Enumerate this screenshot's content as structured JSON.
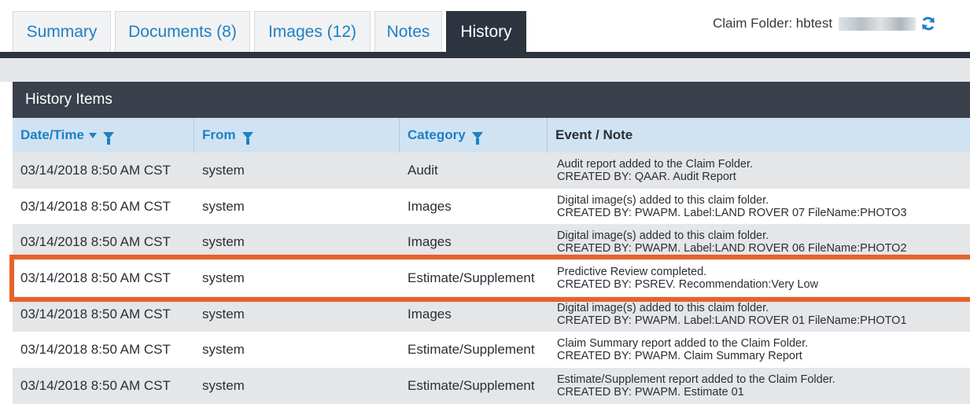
{
  "tabs": [
    {
      "label": "Summary"
    },
    {
      "label": "Documents (8)"
    },
    {
      "label": "Images (12)"
    },
    {
      "label": "Notes"
    },
    {
      "label": "History",
      "active": true
    }
  ],
  "folder": {
    "label": "Claim Folder: hbtest"
  },
  "panel": {
    "title": "History Items"
  },
  "columns": [
    {
      "label": "Date/Time"
    },
    {
      "label": "From"
    },
    {
      "label": "Category"
    },
    {
      "label": "Event / Note"
    }
  ],
  "rows": [
    {
      "datetime": "03/14/2018 8:50 AM CST",
      "from": "system",
      "category": "Audit",
      "event1": "Audit report added to the Claim Folder.",
      "event2": "CREATED BY: QAAR. Audit Report"
    },
    {
      "datetime": "03/14/2018 8:50 AM CST",
      "from": "system",
      "category": "Images",
      "event1": "Digital image(s) added to this claim folder.",
      "event2": "CREATED BY: PWAPM. Label:LAND ROVER 07 FileName:PHOTO3"
    },
    {
      "datetime": "03/14/2018 8:50 AM CST",
      "from": "system",
      "category": "Images",
      "event1": "Digital image(s) added to this claim folder.",
      "event2": "CREATED BY: PWAPM. Label:LAND ROVER 06 FileName:PHOTO2"
    },
    {
      "datetime": "03/14/2018 8:50 AM CST",
      "from": "system",
      "category": "Estimate/Supplement",
      "event1": "Predictive Review completed.",
      "event2": "CREATED BY: PSREV. Recommendation:Very Low"
    },
    {
      "datetime": "03/14/2018 8:50 AM CST",
      "from": "system",
      "category": "Images",
      "event1": "Digital image(s) added to this claim folder.",
      "event2": "CREATED BY: PWAPM. Label:LAND ROVER 01 FileName:PHOTO1"
    },
    {
      "datetime": "03/14/2018 8:50 AM CST",
      "from": "system",
      "category": "Estimate/Supplement",
      "event1": "Claim Summary report added to the Claim Folder.",
      "event2": "CREATED BY: PWAPM. Claim Summary Report"
    },
    {
      "datetime": "03/14/2018 8:50 AM CST",
      "from": "system",
      "category": "Estimate/Supplement",
      "event1": "Estimate/Supplement report added to the Claim Folder.",
      "event2": "CREATED BY: PWAPM. Estimate 01"
    }
  ],
  "colors": {
    "accent": "#1f80c4",
    "dark": "#2d3440",
    "highlight": "#e8612a"
  }
}
